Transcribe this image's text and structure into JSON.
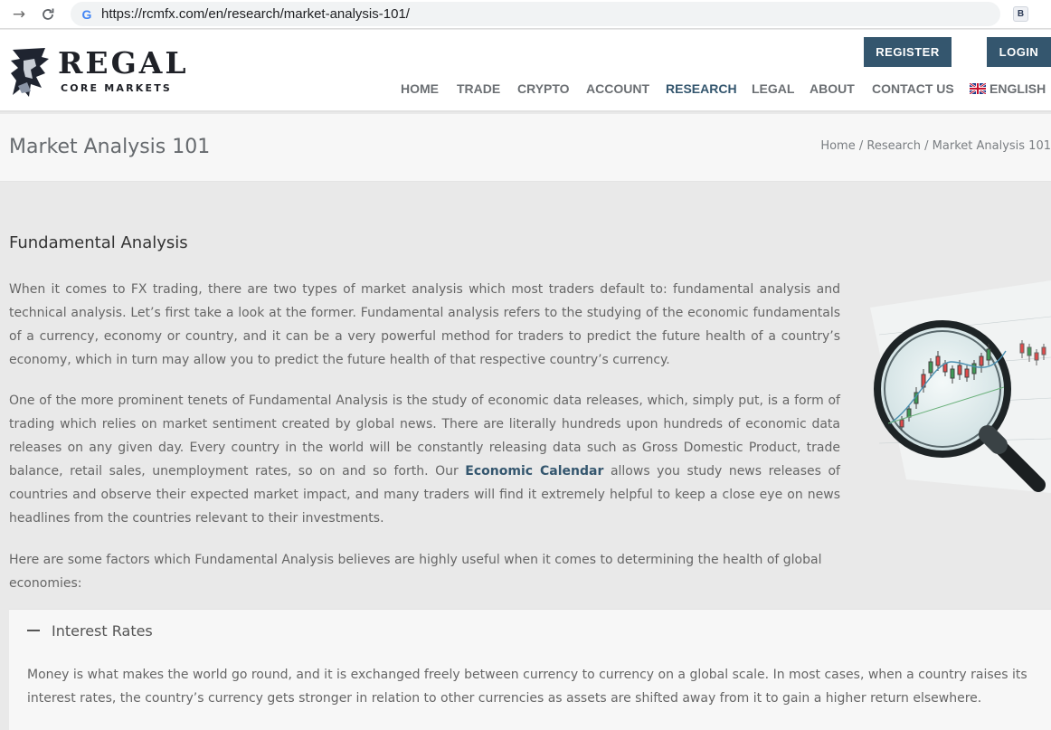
{
  "browser": {
    "url": "https://rcmfx.com/en/research/market-analysis-101/",
    "extension_label": "B"
  },
  "header": {
    "brand_main": "REGAL",
    "brand_sub": "CORE MARKETS",
    "register_label": "REGISTER",
    "login_label": "LOGIN",
    "menu": [
      {
        "label": "HOME"
      },
      {
        "label": "TRADE"
      },
      {
        "label": "CRYPTO"
      },
      {
        "label": "ACCOUNT"
      },
      {
        "label": "RESEARCH"
      },
      {
        "label": "LEGAL"
      },
      {
        "label": "ABOUT"
      },
      {
        "label": "CONTACT US"
      },
      {
        "label": "ENGLISH"
      }
    ],
    "active_item": "RESEARCH",
    "accent_color": "#34566e"
  },
  "titlebar": {
    "title": "Market Analysis 101",
    "crumb_home": "Home",
    "crumb_sep": " / ",
    "crumb_research": "Research",
    "crumb_current": "Market Analysis 101"
  },
  "main": {
    "heading": "Fundamental Analysis",
    "p1": "When it comes to FX trading, there are two types of market analysis which most traders default to: fundamental analysis and technical analysis. Let’s first take a look at the former. Fundamental analysis refers to the studying of the economic fundamentals of a currency, economy or country, and it can be a very powerful method for traders to predict the future health of a country’s economy, which in turn may allow you to predict the future health of that respective country’s currency.",
    "p2_before": "One of the more prominent tenets of Fundamental Analysis is the study of economic data releases, which, simply put, is a form of trading which relies on market sentiment created by global news. There are literally hundreds upon hundreds of economic data releases on any given day. Every country in the world will be constantly releasing data such as Gross Domestic Product, trade balance, retail sales, unemployment rates, so on and so forth. Our ",
    "p2_link": "Economic Calendar",
    "p2_after": " allows you study news releases of countries and observe their expected market impact, and many traders will find it extremely helpful to keep a close eye on news headlines from the countries relevant to their investments.",
    "p3": "Here are some factors which Fundamental Analysis believes are highly useful when it comes to determining the health of global economies:"
  },
  "accordion": {
    "title": "Interest Rates",
    "body": "Money is what makes the world go round, and it is exchanged freely between currency to currency on a global scale. In most cases, when a country raises its interest rates, the country’s currency gets stronger in relation to other currencies as assets are shifted away from it to gain a higher return elsewhere."
  }
}
